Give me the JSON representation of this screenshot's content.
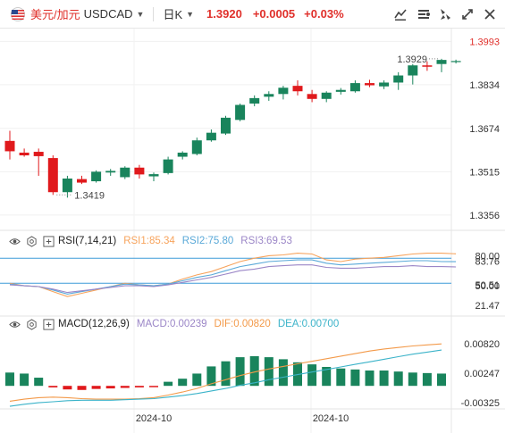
{
  "toolbar": {
    "pair_name": "美元/加元",
    "pair_code": "USDCAD",
    "timeframe": "日K",
    "price": "1.3920",
    "change": "+0.0005",
    "change_pct": "+0.03%",
    "icons": [
      "us-flag-icon",
      "chevron-down-icon",
      "drawing-tools-icon",
      "indicator-icon",
      "objects-icon",
      "fullscreen-icon",
      "close-icon"
    ]
  },
  "colors": {
    "up": "#19845c",
    "down": "#e0191c",
    "accent": "#e0302b",
    "rsi1": "#f7a35c",
    "rsi2": "#5aa9d8",
    "rsi3": "#9b86c7",
    "macd_dif": "#f39a4a",
    "macd_dea": "#3bb3c9",
    "guide": "#3d9bd9"
  },
  "chart_data": [
    {
      "type": "candlestick",
      "title": "USDCAD 日K",
      "y_ticks": [
        "1.3993",
        "1.3834",
        "1.3674",
        "1.3515",
        "1.3356"
      ],
      "ylim": [
        1.33,
        1.404
      ],
      "annotations": {
        "high_label": "1.3929",
        "low_label": "1.3419"
      },
      "x_ticks": [
        "2024-10",
        "2024-10"
      ],
      "candles": [
        {
          "o": 1.3628,
          "h": 1.3665,
          "l": 1.356,
          "c": 1.359
        },
        {
          "o": 1.3585,
          "h": 1.36,
          "l": 1.357,
          "c": 1.3575
        },
        {
          "o": 1.3588,
          "h": 1.36,
          "l": 1.35,
          "c": 1.3572
        },
        {
          "o": 1.3565,
          "h": 1.3575,
          "l": 1.343,
          "c": 1.344
        },
        {
          "o": 1.344,
          "h": 1.35,
          "l": 1.342,
          "c": 1.349
        },
        {
          "o": 1.3488,
          "h": 1.35,
          "l": 1.347,
          "c": 1.3475
        },
        {
          "o": 1.348,
          "h": 1.352,
          "l": 1.3475,
          "c": 1.3515
        },
        {
          "o": 1.3512,
          "h": 1.3525,
          "l": 1.35,
          "c": 1.3518
        },
        {
          "o": 1.3495,
          "h": 1.3535,
          "l": 1.3488,
          "c": 1.353
        },
        {
          "o": 1.353,
          "h": 1.354,
          "l": 1.349,
          "c": 1.3505
        },
        {
          "o": 1.3498,
          "h": 1.3512,
          "l": 1.348,
          "c": 1.3506
        },
        {
          "o": 1.351,
          "h": 1.357,
          "l": 1.3505,
          "c": 1.356
        },
        {
          "o": 1.357,
          "h": 1.359,
          "l": 1.356,
          "c": 1.3585
        },
        {
          "o": 1.358,
          "h": 1.364,
          "l": 1.3575,
          "c": 1.363
        },
        {
          "o": 1.363,
          "h": 1.367,
          "l": 1.3625,
          "c": 1.3658
        },
        {
          "o": 1.3655,
          "h": 1.372,
          "l": 1.365,
          "c": 1.3713
        },
        {
          "o": 1.3705,
          "h": 1.3765,
          "l": 1.37,
          "c": 1.376
        },
        {
          "o": 1.3765,
          "h": 1.3795,
          "l": 1.3755,
          "c": 1.3785
        },
        {
          "o": 1.379,
          "h": 1.381,
          "l": 1.3775,
          "c": 1.38
        },
        {
          "o": 1.38,
          "h": 1.383,
          "l": 1.378,
          "c": 1.3823
        },
        {
          "o": 1.383,
          "h": 1.385,
          "l": 1.3795,
          "c": 1.381
        },
        {
          "o": 1.38,
          "h": 1.3815,
          "l": 1.377,
          "c": 1.3782
        },
        {
          "o": 1.3782,
          "h": 1.381,
          "l": 1.377,
          "c": 1.3805
        },
        {
          "o": 1.3808,
          "h": 1.3822,
          "l": 1.3798,
          "c": 1.3815
        },
        {
          "o": 1.381,
          "h": 1.385,
          "l": 1.3805,
          "c": 1.384
        },
        {
          "o": 1.384,
          "h": 1.3852,
          "l": 1.3825,
          "c": 1.3832
        },
        {
          "o": 1.3828,
          "h": 1.385,
          "l": 1.3818,
          "c": 1.3842
        },
        {
          "o": 1.3842,
          "h": 1.388,
          "l": 1.3815,
          "c": 1.3868
        },
        {
          "o": 1.3868,
          "h": 1.391,
          "l": 1.3835,
          "c": 1.3905
        },
        {
          "o": 1.3905,
          "h": 1.392,
          "l": 1.3885,
          "c": 1.39
        },
        {
          "o": 1.391,
          "h": 1.3929,
          "l": 1.388,
          "c": 1.3925
        },
        {
          "o": 1.392,
          "h": 1.3926,
          "l": 1.3912,
          "c": 1.3921
        }
      ]
    },
    {
      "type": "line",
      "title": "RSI(7,14,21)",
      "y_ticks": [
        "80.00",
        "83.76",
        "50.00",
        "50.51",
        "21.47"
      ],
      "ylim": [
        15,
        92
      ],
      "levels": [
        80,
        50
      ],
      "labels": {
        "rsi1": "RSI1:85.34",
        "rsi2": "RSI2:75.80",
        "rsi3": "RSI3:69.53"
      },
      "series": [
        {
          "name": "RSI1",
          "values": [
            50,
            47,
            46,
            40,
            34,
            38,
            42,
            46,
            50,
            48,
            47,
            49,
            55,
            60,
            64,
            70,
            76,
            80,
            83,
            84,
            86,
            85,
            78,
            76,
            79,
            80,
            81,
            83,
            85,
            86,
            86,
            85.3
          ]
        },
        {
          "name": "RSI2",
          "values": [
            49,
            47,
            46,
            42,
            37,
            40,
            43,
            46,
            49,
            48,
            47,
            49,
            53,
            57,
            60,
            65,
            70,
            73,
            76,
            77,
            78,
            78,
            74,
            72,
            73,
            74,
            75,
            76,
            77,
            77,
            76,
            75.8
          ]
        },
        {
          "name": "RSI3",
          "values": [
            48,
            47,
            46,
            43,
            39,
            41,
            43,
            45,
            47,
            47,
            46,
            48,
            51,
            54,
            57,
            61,
            65,
            67,
            70,
            71,
            72,
            72,
            69,
            68,
            68,
            69,
            70,
            70,
            71,
            70,
            70,
            69.5
          ]
        }
      ]
    },
    {
      "type": "bar",
      "title": "MACD(12,26,9)",
      "y_ticks": [
        "0.00820",
        "0.00247",
        "-0.00325"
      ],
      "ylim": [
        -0.0045,
        0.0105
      ],
      "labels": {
        "macd": "MACD:0.00239",
        "dif": "DIF:0.00820",
        "dea": "DEA:0.00700"
      },
      "values": [
        0.0026,
        0.0024,
        0.0016,
        -0.0003,
        -0.0007,
        -0.0008,
        -0.0006,
        -0.0005,
        -0.0004,
        -0.0003,
        -0.0002,
        0.0008,
        0.0014,
        0.0024,
        0.0038,
        0.0048,
        0.0056,
        0.0058,
        0.0056,
        0.0052,
        0.0046,
        0.0042,
        0.0037,
        0.0034,
        0.0032,
        0.003,
        0.003,
        0.0028,
        0.0026,
        0.0025,
        0.0024
      ],
      "series": [
        {
          "name": "DIF",
          "values": [
            -0.003,
            -0.0026,
            -0.0023,
            -0.0022,
            -0.0023,
            -0.0025,
            -0.0026,
            -0.0026,
            -0.0026,
            -0.0025,
            -0.0023,
            -0.0018,
            -0.0012,
            -0.0005,
            0.0004,
            0.0012,
            0.002,
            0.0027,
            0.0033,
            0.0038,
            0.0043,
            0.0048,
            0.0053,
            0.0058,
            0.0063,
            0.0068,
            0.0072,
            0.0075,
            0.0078,
            0.008,
            0.0082
          ]
        },
        {
          "name": "DEA",
          "values": [
            -0.004,
            -0.0036,
            -0.0033,
            -0.0031,
            -0.0029,
            -0.0028,
            -0.0028,
            -0.0028,
            -0.0027,
            -0.0026,
            -0.0025,
            -0.0022,
            -0.0019,
            -0.0015,
            -0.001,
            -0.0005,
            0.0001,
            0.0006,
            0.0012,
            0.0017,
            0.0022,
            0.0027,
            0.0032,
            0.0037,
            0.0042,
            0.0047,
            0.0052,
            0.0057,
            0.0062,
            0.0066,
            0.007
          ]
        }
      ]
    }
  ]
}
